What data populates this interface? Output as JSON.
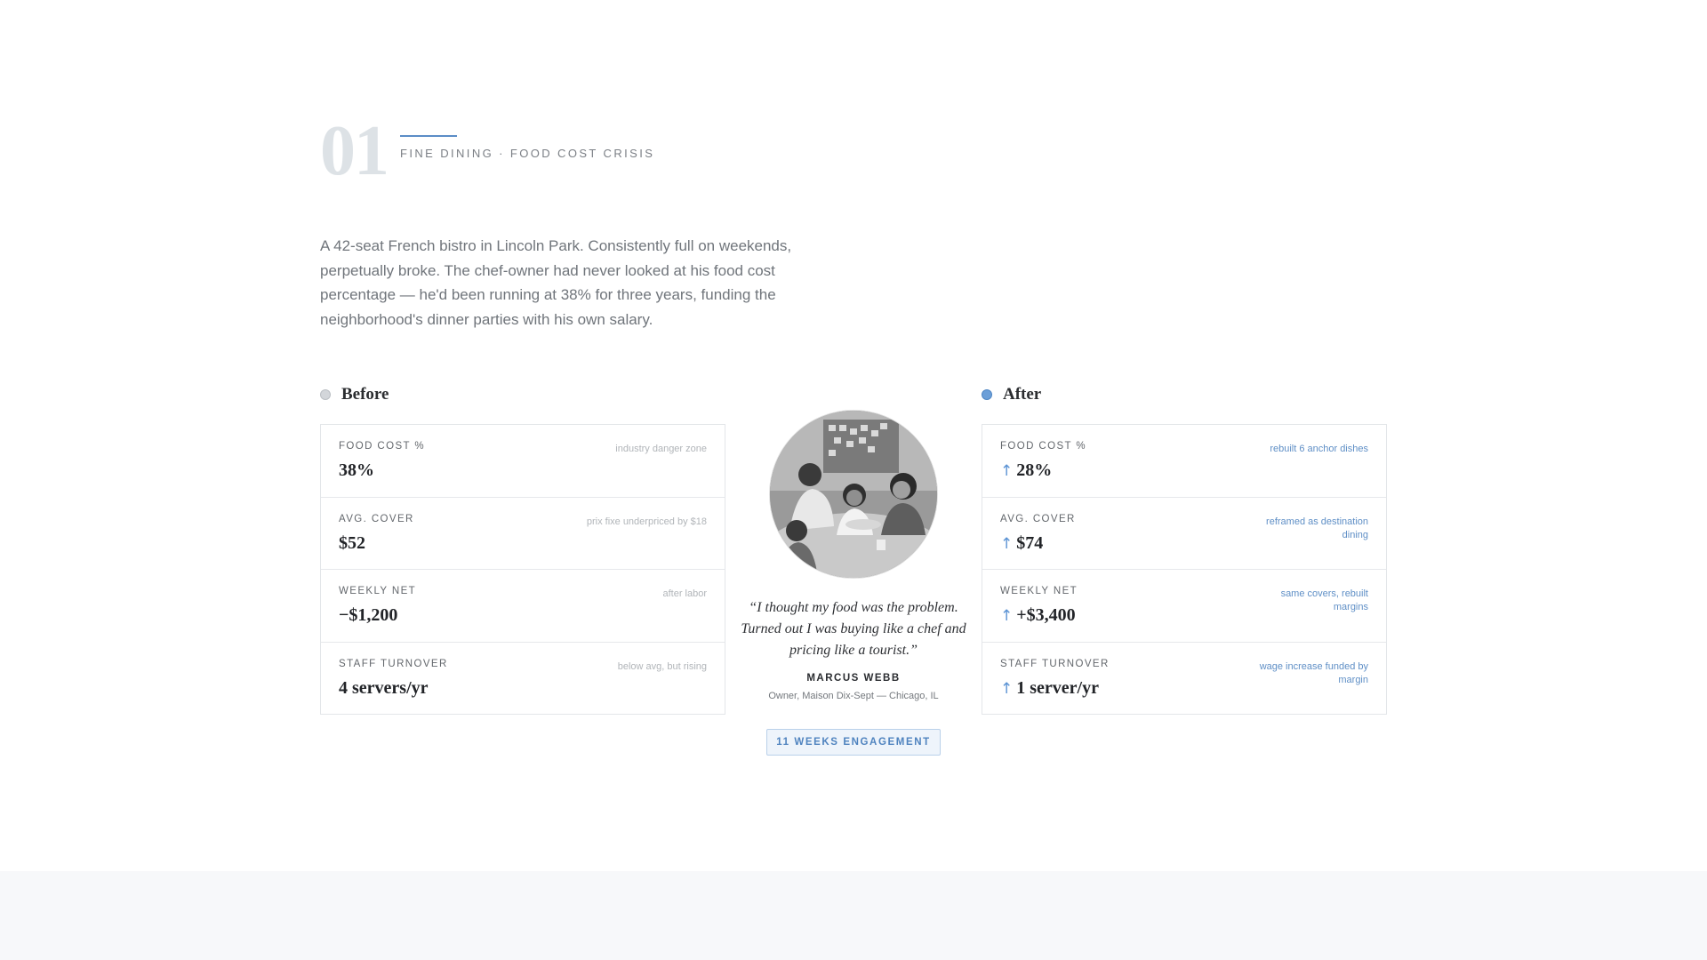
{
  "case": {
    "number": "01",
    "label": "FINE DINING · FOOD COST CRISIS",
    "intro": "A 42-seat French bistro in Lincoln Park. Consistently full on weekends, perpetually broke. The chef-owner had never looked at his food cost percentage — he'd been running at 38% for three years, funding the neighborhood's dinner parties with his own salary."
  },
  "before": {
    "title": "Before",
    "rows": [
      {
        "label": "FOOD COST %",
        "value": "38%",
        "note": "industry danger zone"
      },
      {
        "label": "AVG. COVER",
        "value": "$52",
        "note": "prix fixe underpriced by $18"
      },
      {
        "label": "WEEKLY NET",
        "value": "−$1,200",
        "note": "after labor"
      },
      {
        "label": "STAFF TURNOVER",
        "value": "4 servers/yr",
        "note": "below avg, but rising"
      }
    ]
  },
  "after": {
    "title": "After",
    "arrow": "↑",
    "rows": [
      {
        "label": "FOOD COST %",
        "value": "28%",
        "note": "rebuilt 6 anchor dishes"
      },
      {
        "label": "AVG. COVER",
        "value": "$74",
        "note": "reframed as destination dining"
      },
      {
        "label": "WEEKLY NET",
        "value": "+$3,400",
        "note": "same covers, rebuilt margins"
      },
      {
        "label": "STAFF TURNOVER",
        "value": "1 server/yr",
        "note": "wage increase funded by margin"
      }
    ]
  },
  "testimonial": {
    "quote": "“I thought my food was the problem. Turned out I was buying like a chef and pricing like a tourist.”",
    "author": "MARCUS WEBB",
    "role": "Owner, Maison Dix-Sept — Chicago, IL",
    "photo_alt": "team-meeting-photo"
  },
  "engagement_badge": "11 WEEKS ENGAGEMENT",
  "colors": {
    "accent": "#5b8dc6",
    "before_dot": "#d3d6da",
    "after_dot": "#6c9fd8",
    "case_number": "#dde2e6"
  }
}
